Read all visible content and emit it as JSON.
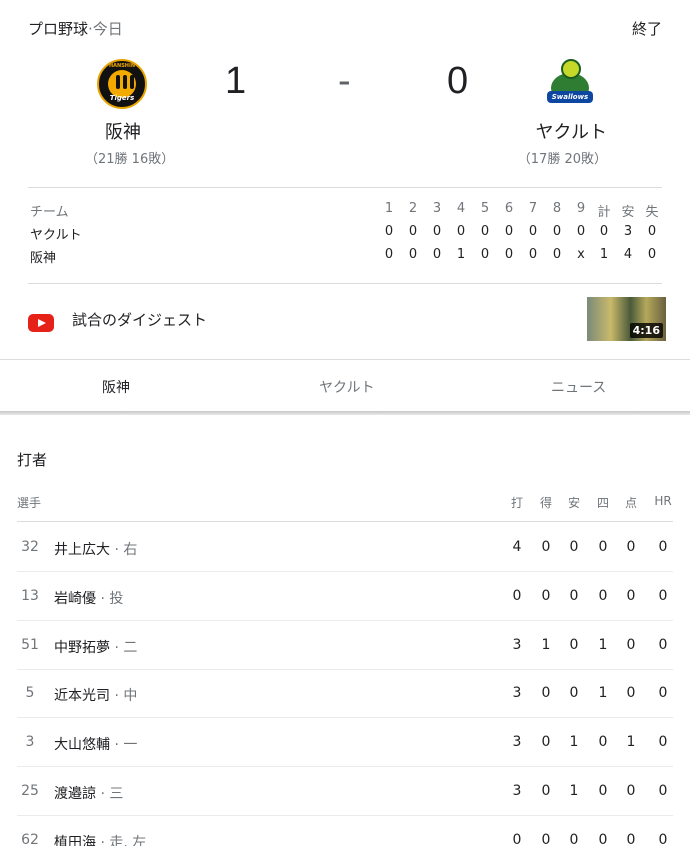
{
  "header": {
    "league": "プロ野球",
    "separator": "·",
    "date": "今日",
    "status": "終了"
  },
  "home": {
    "name": "阪神",
    "record": "（21勝 16敗）",
    "score": "1",
    "logo_text_top": "HANSHIN",
    "logo_text": "Tigers"
  },
  "away": {
    "name": "ヤクルト",
    "record": "（17勝 20敗）",
    "score": "0",
    "logo_text": "Swallows"
  },
  "score_separator": "-",
  "linescore": {
    "team_header": "チーム",
    "columns": [
      "1",
      "2",
      "3",
      "4",
      "5",
      "6",
      "7",
      "8",
      "9",
      "計",
      "安",
      "失"
    ],
    "rows": [
      {
        "team": "ヤクルト",
        "cells": [
          "0",
          "0",
          "0",
          "0",
          "0",
          "0",
          "0",
          "0",
          "0",
          "0",
          "3",
          "0"
        ]
      },
      {
        "team": "阪神",
        "cells": [
          "0",
          "0",
          "0",
          "1",
          "0",
          "0",
          "0",
          "0",
          "x",
          "1",
          "4",
          "0"
        ]
      }
    ]
  },
  "digest": {
    "label": "試合のダイジェスト",
    "duration": "4:16",
    "icon": "youtube-icon"
  },
  "tabs": [
    {
      "label": "阪神"
    },
    {
      "label": "ヤクルト"
    },
    {
      "label": "ニュース"
    }
  ],
  "batting": {
    "title": "打者",
    "player_header": "選手",
    "columns": [
      "打",
      "得",
      "安",
      "四",
      "点",
      "HR"
    ],
    "players": [
      {
        "num": "32",
        "name": "井上広大",
        "pos": " · 右",
        "stats": [
          "4",
          "0",
          "0",
          "0",
          "0",
          "0"
        ]
      },
      {
        "num": "13",
        "name": "岩崎優",
        "pos": " · 投",
        "stats": [
          "0",
          "0",
          "0",
          "0",
          "0",
          "0"
        ]
      },
      {
        "num": "51",
        "name": "中野拓夢",
        "pos": " · 二",
        "stats": [
          "3",
          "1",
          "0",
          "1",
          "0",
          "0"
        ]
      },
      {
        "num": "5",
        "name": "近本光司",
        "pos": " · 中",
        "stats": [
          "3",
          "0",
          "0",
          "1",
          "0",
          "0"
        ]
      },
      {
        "num": "3",
        "name": "大山悠輔",
        "pos": " · 一",
        "stats": [
          "3",
          "0",
          "1",
          "0",
          "1",
          "0"
        ]
      },
      {
        "num": "25",
        "name": "渡邉諒",
        "pos": " · 三",
        "stats": [
          "3",
          "0",
          "1",
          "0",
          "0",
          "0"
        ]
      },
      {
        "num": "62",
        "name": "植田海",
        "pos": " · 走, 左",
        "stats": [
          "0",
          "0",
          "0",
          "0",
          "0",
          "0"
        ]
      }
    ]
  }
}
